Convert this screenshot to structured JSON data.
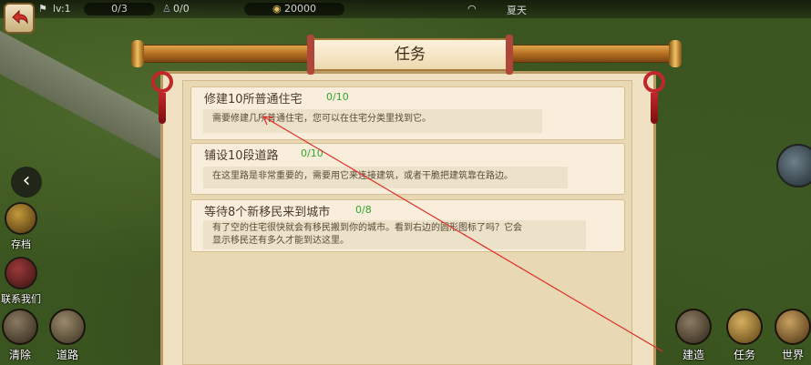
{
  "topbar": {
    "level": "lv:1",
    "population": "0/3",
    "workers": "0/0",
    "gold": "20000",
    "season": "夏天"
  },
  "dialog": {
    "title": "任务"
  },
  "quests": [
    {
      "title": "修建10所普通住宅",
      "progress": "0/10",
      "desc_lines": [
        "需要修建几所普通住宅，您可以在住宅分类里找到它。"
      ]
    },
    {
      "title": "铺设10段道路",
      "progress": "0/10",
      "desc_lines": [
        "在这里路是非常重要的，需要用它来连接建筑，或者干脆把建筑靠在路边。"
      ]
    },
    {
      "title": "等待8个新移民来到城市",
      "progress": "0/8",
      "desc_lines": [
        "有了空的住宅很快就会有移民搬到你的城市。看到右边的圆形图标了吗？它会",
        "显示移民还有多久才能到达这里。"
      ]
    }
  ],
  "left_menu": {
    "save": "存档",
    "contact": "联系我们",
    "clear": "清除",
    "road": "道路"
  },
  "bottom_menu": {
    "build": "建造",
    "tasks": "任务",
    "world": "世界"
  },
  "icons": {
    "back": "back-arrow-icon",
    "side_toggle": "chevron-left-icon",
    "save": "chest-icon",
    "contact": "book-icon",
    "clear": "shovel-icon",
    "road": "road-icon",
    "build": "hammer-icon",
    "tasks": "scroll-icon",
    "world": "world-map-icon",
    "gold": "coin-icon",
    "season": "fan-icon",
    "migrant": "migrant-timer-icon"
  },
  "colors": {
    "progress_green": "#2ea82e",
    "rope": "#c07a2a",
    "knot_red": "#c0262a",
    "panel_bg": "#efe1c2"
  }
}
